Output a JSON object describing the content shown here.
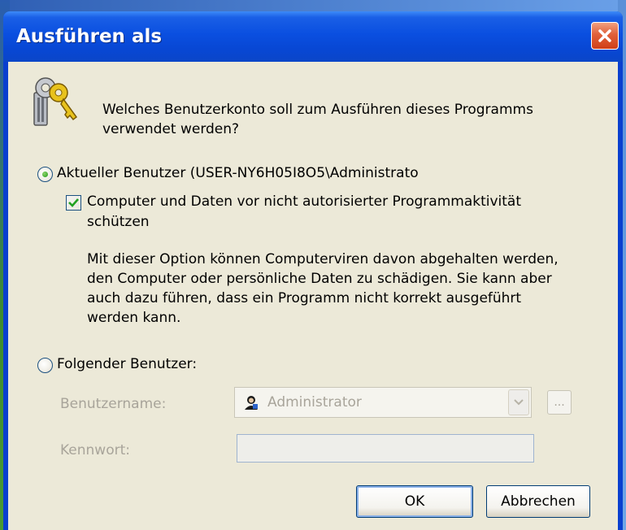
{
  "window": {
    "title": "Ausführen als"
  },
  "prompt": {
    "line1": "Welches Benutzerkonto soll zum Ausführen dieses Programms",
    "line2": "verwendet werden?"
  },
  "current_user": {
    "label": "Aktueller Benutzer (USER-NY6H05I8O5\\Administrato",
    "selected": true,
    "protect_checkbox": {
      "line1": "Computer und Daten vor nicht autorisierter Programmaktivität",
      "line2": "schützen",
      "checked": true
    },
    "description": [
      "Mit dieser Option können Computerviren davon abgehalten werden,",
      "den Computer oder persönliche Daten zu schädigen. Sie kann aber",
      "auch dazu führen, dass ein Programm nicht korrekt ausgeführt",
      "werden kann."
    ]
  },
  "other_user": {
    "label": "Folgender Benutzer:",
    "selected": false,
    "username_label": "Benutzername:",
    "username_value": "Administrator",
    "browse_label": "...",
    "password_label": "Kennwort:",
    "password_value": ""
  },
  "buttons": {
    "ok": "OK",
    "cancel": "Abbrechen"
  },
  "icons": {
    "title_close": "close-icon",
    "keys": "keys-icon",
    "user": "user-icon",
    "dropdown": "chevron-down-icon"
  },
  "colors": {
    "titlebar": "#0a4fe0",
    "client": "#ece9d8",
    "close": "#e0603a",
    "disabled_text": "#a8a49a"
  }
}
